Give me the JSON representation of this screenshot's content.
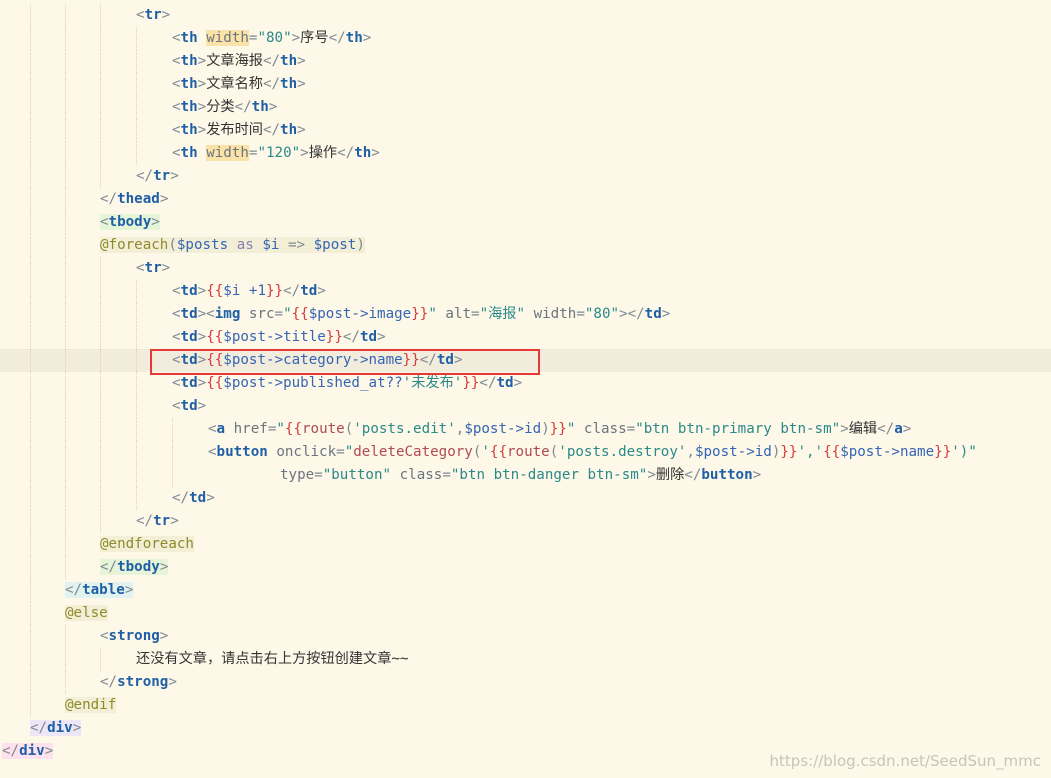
{
  "editor": {
    "lines": [
      {
        "indent": 136,
        "guides": [
          30,
          65,
          100
        ],
        "html": "<span class='t-punct'>&lt;</span><span class='t-tag'>tr</span><span class='t-punct'>&gt;</span>"
      },
      {
        "indent": 172,
        "guides": [
          30,
          65,
          100,
          136
        ],
        "html": "<span class='t-punct'>&lt;</span><span class='t-tag'>th</span> <span class='t-attrhl'>width</span><span class='t-punct'>=</span><span class='t-str'>\"80\"</span><span class='t-punct'>&gt;</span><span class='t-text'>序号</span><span class='t-punct'>&lt;/</span><span class='t-tag'>th</span><span class='t-punct'>&gt;</span>"
      },
      {
        "indent": 172,
        "guides": [
          30,
          65,
          100,
          136
        ],
        "html": "<span class='t-punct'>&lt;</span><span class='t-tag'>th</span><span class='t-punct'>&gt;</span><span class='t-text'>文章海报</span><span class='t-punct'>&lt;/</span><span class='t-tag'>th</span><span class='t-punct'>&gt;</span>"
      },
      {
        "indent": 172,
        "guides": [
          30,
          65,
          100,
          136
        ],
        "html": "<span class='t-punct'>&lt;</span><span class='t-tag'>th</span><span class='t-punct'>&gt;</span><span class='t-text'>文章名称</span><span class='t-punct'>&lt;/</span><span class='t-tag'>th</span><span class='t-punct'>&gt;</span>"
      },
      {
        "indent": 172,
        "guides": [
          30,
          65,
          100,
          136
        ],
        "html": "<span class='t-punct'>&lt;</span><span class='t-tag'>th</span><span class='t-punct'>&gt;</span><span class='t-text'>分类</span><span class='t-punct'>&lt;/</span><span class='t-tag'>th</span><span class='t-punct'>&gt;</span>"
      },
      {
        "indent": 172,
        "guides": [
          30,
          65,
          100,
          136
        ],
        "html": "<span class='t-punct'>&lt;</span><span class='t-tag'>th</span><span class='t-punct'>&gt;</span><span class='t-text'>发布时间</span><span class='t-punct'>&lt;/</span><span class='t-tag'>th</span><span class='t-punct'>&gt;</span>"
      },
      {
        "indent": 172,
        "guides": [
          30,
          65,
          100,
          136
        ],
        "html": "<span class='t-punct'>&lt;</span><span class='t-tag'>th</span> <span class='t-attrhl'>width</span><span class='t-punct'>=</span><span class='t-str'>\"120\"</span><span class='t-punct'>&gt;</span><span class='t-text'>操作</span><span class='t-punct'>&lt;/</span><span class='t-tag'>th</span><span class='t-punct'>&gt;</span>"
      },
      {
        "indent": 136,
        "guides": [
          30,
          65,
          100
        ],
        "html": "<span class='t-punct'>&lt;/</span><span class='t-tag'>tr</span><span class='t-punct'>&gt;</span>"
      },
      {
        "indent": 100,
        "guides": [
          30,
          65
        ],
        "html": "<span class='t-punct'>&lt;/</span><span class='t-tag'>thead</span><span class='t-punct'>&gt;</span>"
      },
      {
        "indent": 100,
        "guides": [
          30,
          65
        ],
        "html": "<span class='tagbg-tbody'><span class='t-punct'>&lt;</span><span class='t-tag'>tbody</span><span class='t-punct'>&gt;</span></span>"
      },
      {
        "indent": 100,
        "guides": [
          30,
          65
        ],
        "html": "<span class='tagbg-dir'><span class='t-dir'>@foreach</span><span class='t-punct'>(</span><span class='t-var'>$posts</span> <span class='t-kw'>as</span> <span class='t-var'>$i</span> <span class='t-punct'>=&gt;</span> <span class='t-var'>$post</span><span class='t-punct'>)</span></span>"
      },
      {
        "indent": 136,
        "guides": [
          30,
          65,
          100
        ],
        "html": "<span class='t-punct'>&lt;</span><span class='t-tag'>tr</span><span class='t-punct'>&gt;</span>"
      },
      {
        "indent": 172,
        "guides": [
          30,
          65,
          100,
          136
        ],
        "html": "<span class='t-punct'>&lt;</span><span class='t-tag'>td</span><span class='t-punct'>&gt;</span><span class='t-brace'>{{</span><span class='t-var'>$i +1</span><span class='t-brace'>}}</span><span class='t-punct'>&lt;/</span><span class='t-tag'>td</span><span class='t-punct'>&gt;</span>"
      },
      {
        "indent": 172,
        "guides": [
          30,
          65,
          100,
          136
        ],
        "html": "<span class='t-punct'>&lt;</span><span class='t-tag'>td</span><span class='t-punct'>&gt;&lt;</span><span class='t-tag'>img</span> <span class='t-attr'>src</span><span class='t-punct'>=</span><span class='t-str'>\"</span><span class='t-brace'>{{</span><span class='t-var'>$post-&gt;image</span><span class='t-brace'>}}</span><span class='t-str'>\"</span> <span class='t-attr'>alt</span><span class='t-punct'>=</span><span class='t-str'>\"海报\"</span> <span class='t-attr'>width</span><span class='t-punct'>=</span><span class='t-str'>\"80\"</span><span class='t-punct'>&gt;&lt;/</span><span class='t-tag'>td</span><span class='t-punct'>&gt;</span>"
      },
      {
        "indent": 172,
        "guides": [
          30,
          65,
          100,
          136
        ],
        "html": "<span class='t-punct'>&lt;</span><span class='t-tag'>td</span><span class='t-punct'>&gt;</span><span class='t-brace'>{{</span><span class='t-var'>$post-&gt;title</span><span class='t-brace'>}}</span><span class='t-punct'>&lt;/</span><span class='t-tag'>td</span><span class='t-punct'>&gt;</span>"
      },
      {
        "indent": 172,
        "guides": [
          30,
          65,
          100,
          136
        ],
        "current": true,
        "html": "<span class='t-punct'>&lt;</span><span class='t-tag'>td</span><span class='t-punct'>&gt;</span><span class='t-brace'>{{</span><span class='t-var'>$post-&gt;category-&gt;name</span><span class='t-brace'>}}</span><span class='t-punct'>&lt;/</span><span class='t-tag'>td</span><span class='t-punct'>&gt;</span>"
      },
      {
        "indent": 172,
        "guides": [
          30,
          65,
          100,
          136
        ],
        "html": "<span class='t-punct'>&lt;</span><span class='t-tag'>td</span><span class='t-punct'>&gt;</span><span class='t-brace'>{{</span><span class='t-var'>$post-&gt;published_at??</span><span class='t-str'>'未发布'</span><span class='t-brace'>}}</span><span class='t-punct'>&lt;/</span><span class='t-tag'>td</span><span class='t-punct'>&gt;</span>"
      },
      {
        "indent": 172,
        "guides": [
          30,
          65,
          100,
          136
        ],
        "html": "<span class='t-punct'>&lt;</span><span class='t-tag'>td</span><span class='t-punct'>&gt;</span>"
      },
      {
        "indent": 208,
        "guides": [
          30,
          65,
          100,
          136,
          172
        ],
        "html": "<span class='t-punct'>&lt;</span><span class='t-tag'>a</span> <span class='t-attr'>href</span><span class='t-punct'>=</span><span class='t-str'>\"</span><span class='t-brace'>{{</span><span class='t-fn'>route</span><span class='t-punct'>(</span><span class='t-str'>'posts.edit'</span><span class='t-punct'>,</span><span class='t-var'>$post-&gt;id</span><span class='t-punct'>)</span><span class='t-brace'>}}</span><span class='t-str'>\"</span> <span class='t-attr'>class</span><span class='t-punct'>=</span><span class='t-str'>\"btn btn-primary btn-sm\"</span><span class='t-punct'>&gt;</span><span class='t-text'>编辑</span><span class='t-punct'>&lt;/</span><span class='t-tag'>a</span><span class='t-punct'>&gt;</span>"
      },
      {
        "indent": 208,
        "guides": [
          30,
          65,
          100,
          136,
          172
        ],
        "html": "<span class='t-punct'>&lt;</span><span class='t-tag'>button</span> <span class='t-attr'>onclick</span><span class='t-punct'>=</span><span class='t-str'>\"</span><span class='t-fn'>deleteCategory</span><span class='t-punct'>(</span><span class='t-str'>'</span><span class='t-brace'>{{</span><span class='t-fn'>route</span><span class='t-punct'>(</span><span class='t-str'>'posts.destroy'</span><span class='t-punct'>,</span><span class='t-var'>$post-&gt;id</span><span class='t-punct'>)</span><span class='t-brace'>}}</span><span class='t-str'>','</span><span class='t-brace'>{{</span><span class='t-var'>$post-&gt;name</span><span class='t-brace'>}}</span><span class='t-str'>')\"</span>"
      },
      {
        "indent": 280,
        "guides": [
          30,
          65,
          100,
          136,
          172
        ],
        "html": "<span class='t-attr'>type</span><span class='t-punct'>=</span><span class='t-str'>\"button\"</span> <span class='t-attr'>class</span><span class='t-punct'>=</span><span class='t-str'>\"btn btn-danger btn-sm\"</span><span class='t-punct'>&gt;</span><span class='t-text'>删除</span><span class='t-punct'>&lt;/</span><span class='t-tag'>button</span><span class='t-punct'>&gt;</span>"
      },
      {
        "indent": 172,
        "guides": [
          30,
          65,
          100,
          136
        ],
        "html": "<span class='t-punct'>&lt;/</span><span class='t-tag'>td</span><span class='t-punct'>&gt;</span>"
      },
      {
        "indent": 136,
        "guides": [
          30,
          65,
          100
        ],
        "html": "<span class='t-punct'>&lt;/</span><span class='t-tag'>tr</span><span class='t-punct'>&gt;</span>"
      },
      {
        "indent": 100,
        "guides": [
          30,
          65
        ],
        "html": "<span class='tagbg-dir'><span class='t-dir'>@endforeach</span></span>"
      },
      {
        "indent": 100,
        "guides": [
          30,
          65
        ],
        "html": "<span class='tagbg-tbody'><span class='t-punct'>&lt;/</span><span class='t-tag'>tbody</span><span class='t-punct'>&gt;</span></span>"
      },
      {
        "indent": 65,
        "guides": [
          30
        ],
        "html": "<span class='tagbg-table'><span class='t-punct'>&lt;/</span><span class='t-tag'>table</span><span class='t-punct'>&gt;</span></span>"
      },
      {
        "indent": 65,
        "guides": [
          30
        ],
        "html": "<span class='tagbg-dir'><span class='t-dir'>@else</span></span>"
      },
      {
        "indent": 100,
        "guides": [
          30,
          65
        ],
        "html": "<span class='t-punct'>&lt;</span><span class='t-tag'>strong</span><span class='t-punct'>&gt;</span>"
      },
      {
        "indent": 136,
        "guides": [
          30,
          65,
          100
        ],
        "html": "<span class='t-text'>还没有文章，请点击右上方按钮创建文章~~</span>"
      },
      {
        "indent": 100,
        "guides": [
          30,
          65
        ],
        "html": "<span class='t-punct'>&lt;/</span><span class='t-tag'>strong</span><span class='t-punct'>&gt;</span>"
      },
      {
        "indent": 65,
        "guides": [
          30
        ],
        "html": "<span class='tagbg-dir'><span class='t-dir'>@endif</span></span>"
      },
      {
        "indent": 30,
        "guides": [],
        "html": "<span class='tagbg-div'><span class='t-punct'>&lt;/</span><span class='t-tag'>div</span><span class='t-punct'>&gt;</span></span>"
      },
      {
        "indent": 2,
        "guides": [],
        "html": "<span class='tagbg-div2'><span class='t-punct'>&lt;/</span><span class='t-tag'>div</span><span class='t-punct'>&gt;</span></span>"
      }
    ]
  },
  "annotation": {
    "label": "highlighted-line",
    "color": "#e53935"
  },
  "watermark": "https://blog.csdn.net/SeedSun_mmc"
}
